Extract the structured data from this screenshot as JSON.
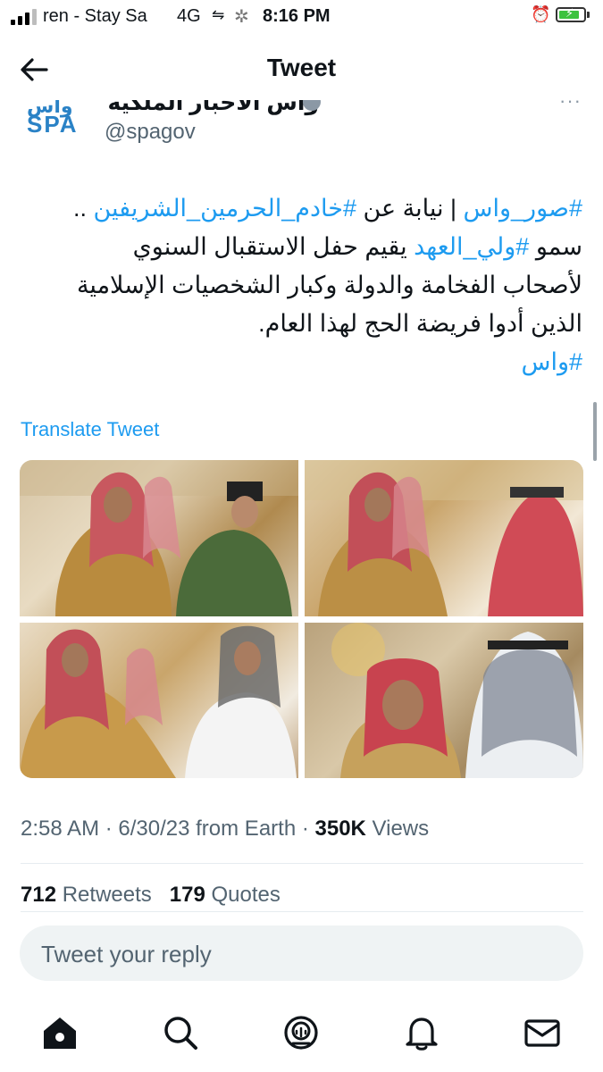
{
  "status_bar": {
    "carrier": "ren - Stay Sa",
    "network": "4G",
    "hotspot_icon": "link-icon",
    "time": "8:16 PM",
    "signal_bars": 3,
    "battery_level": 0.85,
    "battery_color": "#3cc23f"
  },
  "header": {
    "title": "Tweet",
    "back_icon": "arrow-left-icon"
  },
  "author": {
    "display_name": "واس الأخبار الملكية",
    "handle": "@spagov",
    "logo_line1": "واس",
    "logo_line2": "SPA"
  },
  "tweet": {
    "line1": {
      "tag1": "#صور_واس",
      "sep": " | نيابة عن ",
      "tag2": "#خادم_الحرمين_الشريفين",
      "tail": " .."
    },
    "line2": {
      "head": "سمو ",
      "tag": "#ولي_العهد",
      "tail": " يقيم حفل الاستقبال السنوي"
    },
    "line3": "لأصحاب الفخامة والدولة وكبار الشخصيات الإسلامية",
    "line4": "الذين أدوا فريضة الحج لهذا العام.",
    "line5": "#واس",
    "translate_label": "Translate Tweet"
  },
  "media": {
    "count": 4
  },
  "meta": {
    "time": "2:58 AM",
    "date": "6/30/23",
    "source": "from Earth",
    "views_count": "350K",
    "views_label": "Views"
  },
  "stats": {
    "retweets_count": "712",
    "retweets_label": "Retweets",
    "quotes_count": "179",
    "quotes_label": "Quotes"
  },
  "reply": {
    "placeholder": "Tweet your reply"
  },
  "tabbar": {
    "items": [
      "home-icon",
      "search-icon",
      "spaces-icon",
      "notifications-icon",
      "messages-icon"
    ]
  },
  "colors": {
    "accent": "#1d9bf0",
    "text": "#0f1419",
    "muted": "#536471"
  }
}
